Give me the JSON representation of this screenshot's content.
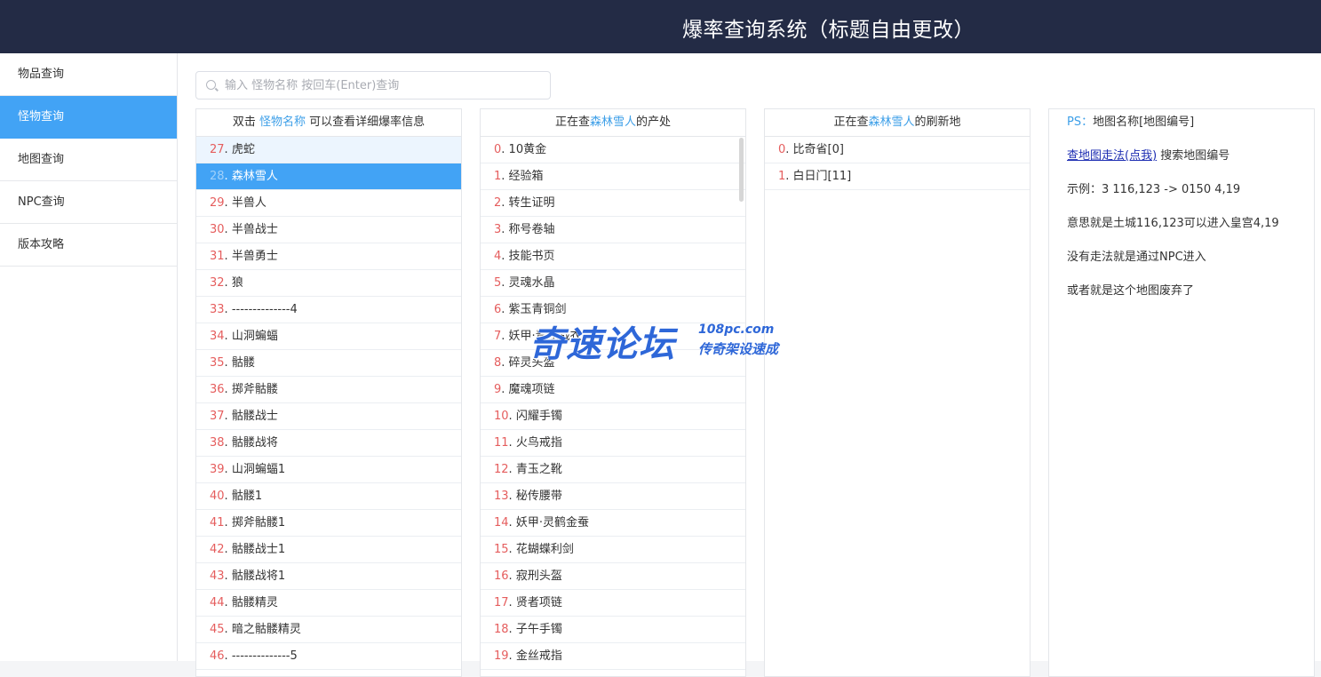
{
  "header": {
    "title": "爆率查询系统（标题自由更改）"
  },
  "sidebar": {
    "items": [
      {
        "label": "物品查询"
      },
      {
        "label": "怪物查询"
      },
      {
        "label": "地图查询"
      },
      {
        "label": "NPC查询"
      },
      {
        "label": "版本攻略"
      }
    ],
    "active_index": 1
  },
  "search": {
    "placeholder": "输入 怪物名称 按回车(Enter)查询",
    "value": ""
  },
  "monster_panel": {
    "head_prefix": "双击 ",
    "head_highlight": "怪物名称",
    "head_suffix": " 可以查看详细爆率信息",
    "rows": [
      {
        "num": "27",
        "name": "虎蛇"
      },
      {
        "num": "28",
        "name": "森林雪人"
      },
      {
        "num": "29",
        "name": "半兽人"
      },
      {
        "num": "30",
        "name": "半兽战士"
      },
      {
        "num": "31",
        "name": "半兽勇士"
      },
      {
        "num": "32",
        "name": "狼"
      },
      {
        "num": "33",
        "name": "--------------4"
      },
      {
        "num": "34",
        "name": "山洞蝙蝠"
      },
      {
        "num": "35",
        "name": "骷髅"
      },
      {
        "num": "36",
        "name": "掷斧骷髅"
      },
      {
        "num": "37",
        "name": "骷髅战士"
      },
      {
        "num": "38",
        "name": "骷髅战将"
      },
      {
        "num": "39",
        "name": "山洞蝙蝠1"
      },
      {
        "num": "40",
        "name": "骷髅1"
      },
      {
        "num": "41",
        "name": "掷斧骷髅1"
      },
      {
        "num": "42",
        "name": "骷髅战士1"
      },
      {
        "num": "43",
        "name": "骷髅战将1"
      },
      {
        "num": "44",
        "name": "骷髅精灵"
      },
      {
        "num": "45",
        "name": "暗之骷髅精灵"
      },
      {
        "num": "46",
        "name": "--------------5"
      }
    ]
  },
  "drops_panel": {
    "head_prefix": "正在查",
    "head_highlight": "森林雪人",
    "head_suffix": "的产处",
    "rows": [
      {
        "num": "0",
        "name": "10黄金"
      },
      {
        "num": "1",
        "name": "经验箱"
      },
      {
        "num": "2",
        "name": "转生证明"
      },
      {
        "num": "3",
        "name": "称号卷轴"
      },
      {
        "num": "4",
        "name": "技能书页"
      },
      {
        "num": "5",
        "name": "灵魂水晶"
      },
      {
        "num": "6",
        "name": "紫玉青铜剑"
      },
      {
        "num": "7",
        "name": "妖甲·青蛇战衣"
      },
      {
        "num": "8",
        "name": "碎灵头盔"
      },
      {
        "num": "9",
        "name": "魔魂项链"
      },
      {
        "num": "10",
        "name": "闪耀手镯"
      },
      {
        "num": "11",
        "name": "火鸟戒指"
      },
      {
        "num": "12",
        "name": "青玉之靴"
      },
      {
        "num": "13",
        "name": "秘传腰带"
      },
      {
        "num": "14",
        "name": "妖甲·灵鹤金蚕"
      },
      {
        "num": "15",
        "name": "花蝴蝶利剑"
      },
      {
        "num": "16",
        "name": "寂刑头盔"
      },
      {
        "num": "17",
        "name": "贤者项链"
      },
      {
        "num": "18",
        "name": "子午手镯"
      },
      {
        "num": "19",
        "name": "金丝戒指"
      }
    ]
  },
  "maps_panel": {
    "head_prefix": "正在查",
    "head_highlight": "森林雪人",
    "head_suffix": "的刷新地",
    "rows": [
      {
        "num": "0",
        "name": "比奇省[0]"
      },
      {
        "num": "1",
        "name": "白日门[11]"
      }
    ]
  },
  "ps_panel": {
    "ps_label": "PS：",
    "ps_text": "地图名称[地图编号]",
    "link_text": "查地图走法(点我)",
    "link_suffix": " 搜索地图编号",
    "example": "示例：3 116,123 -> 0150 4,19",
    "meaning": "意思就是土城116,123可以进入皇宫4,19",
    "no_route": "没有走法就是通过NPC进入",
    "abandoned": "或者就是这个地图废弃了"
  },
  "watermark": {
    "main": "奇速论坛",
    "url": "108pc.com",
    "sub": "传奇架设速成"
  },
  "colors": {
    "header_bg": "#232b45",
    "accent": "#42a3f5",
    "index_red": "#e55d5d",
    "link_blue": "#3d9fe8"
  }
}
